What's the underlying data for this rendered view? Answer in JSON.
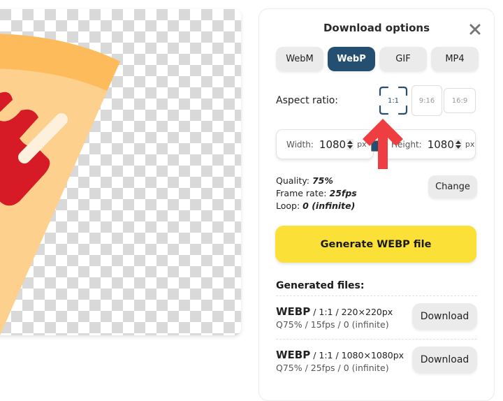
{
  "panel": {
    "title": "Download options",
    "close_icon": "close-icon",
    "formats": [
      {
        "label": "WebM",
        "active": false
      },
      {
        "label": "WebP",
        "active": true
      },
      {
        "label": "GIF",
        "active": false
      },
      {
        "label": "MP4",
        "active": false
      }
    ],
    "aspect_ratio": {
      "label": "Aspect ratio:",
      "options": [
        "1:1",
        "9:16",
        "16:9"
      ],
      "selected": "1:1"
    },
    "dimensions": {
      "width_label": "Width:",
      "width_value": "1080",
      "height_label": "Height:",
      "height_value": "1080",
      "unit": "px",
      "link_icon": "link-icon"
    },
    "settings": {
      "quality_label": "Quality:",
      "quality_value": "75%",
      "frame_rate_label": "Frame rate:",
      "frame_rate_value": "25fps",
      "loop_label": "Loop:",
      "loop_value": "0 (infinite)",
      "change_label": "Change"
    },
    "generate_label": "Generate WEBP file",
    "generated_title": "Generated files:",
    "files": [
      {
        "format": "WEBP",
        "meta": " / 1:1 / 220×220px",
        "details": "Q75% / 15fps / 0 (infinite)",
        "download_label": "Download"
      },
      {
        "format": "WEBP",
        "meta": " / 1:1 / 1080×1080px",
        "details": "Q75% / 25fps / 0 (infinite)",
        "download_label": "Download"
      }
    ]
  },
  "colors": {
    "accent": "#244f70",
    "generate_button": "#fbe037",
    "annotation_arrow": "#ef3e42"
  }
}
